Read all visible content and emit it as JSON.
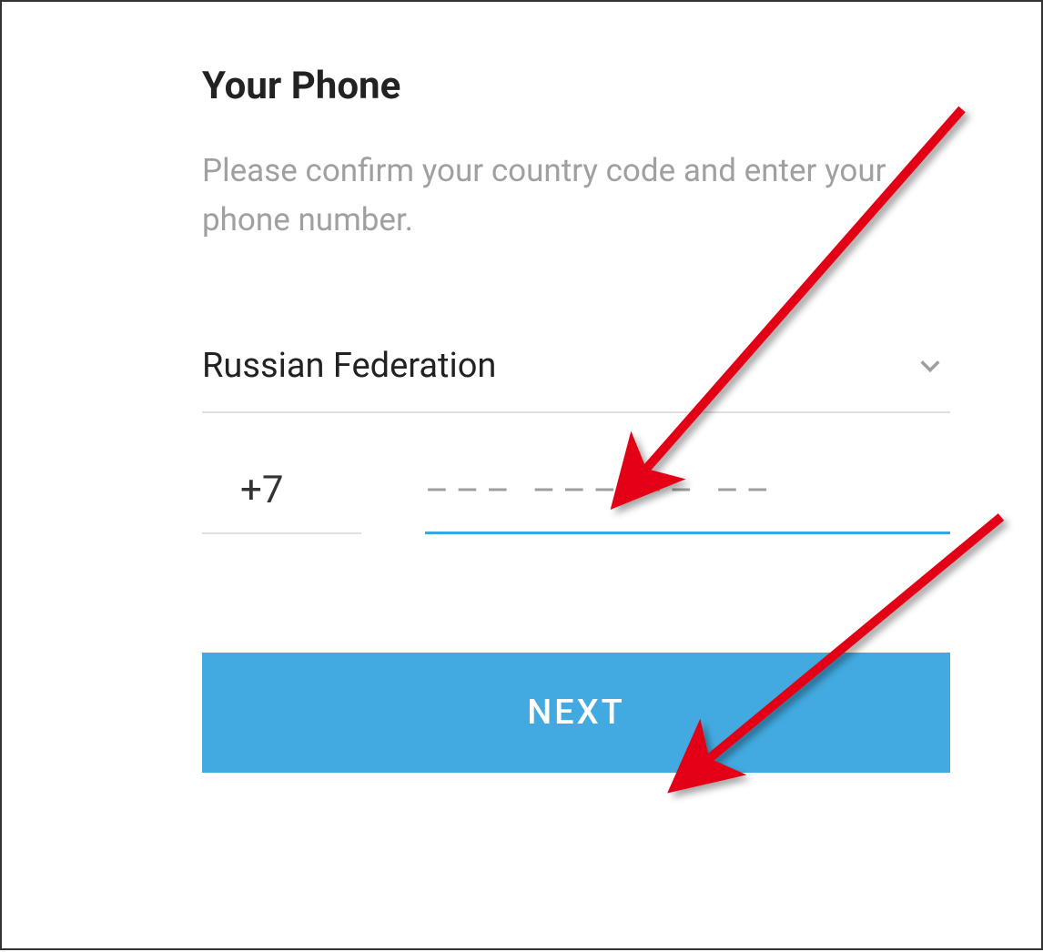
{
  "title": "Your Phone",
  "subtitle": "Please confirm your country code and enter your phone number.",
  "country": {
    "selected": "Russian Federation"
  },
  "phone": {
    "prefix": "+7",
    "placeholder": "––– ––– –– ––"
  },
  "button": {
    "next_label": "NEXT"
  }
}
